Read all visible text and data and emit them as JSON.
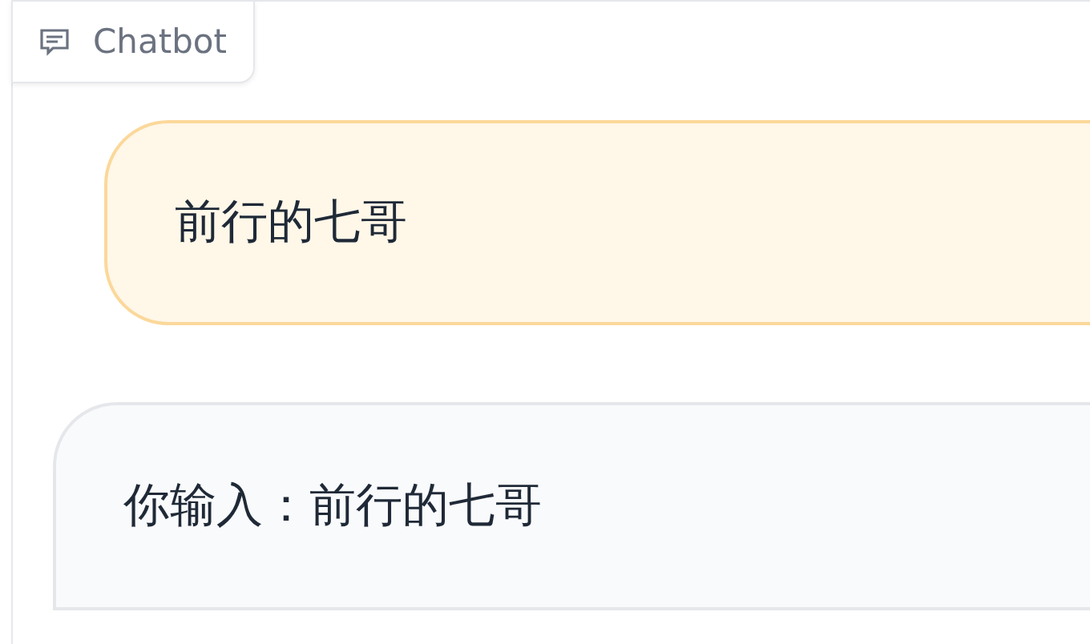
{
  "label": "Chatbot",
  "messages": [
    {
      "kind": "user",
      "text": "前行的七哥"
    },
    {
      "kind": "bot",
      "text": "你输入：前行的七哥"
    }
  ]
}
